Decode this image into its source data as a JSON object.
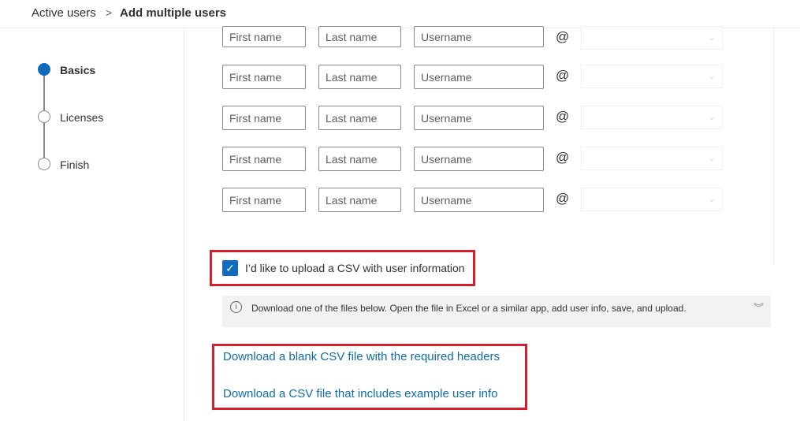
{
  "breadcrumb": {
    "parent": "Active users",
    "separator": ">",
    "current": "Add multiple users"
  },
  "steps": [
    {
      "label": "Basics",
      "active": true
    },
    {
      "label": "Licenses",
      "active": false
    },
    {
      "label": "Finish",
      "active": false
    }
  ],
  "rows": {
    "first_placeholder": "First name",
    "last_placeholder": "Last name",
    "user_placeholder": "Username",
    "at": "@",
    "count": 5
  },
  "csv_checkbox": {
    "label": "I’d like to upload a CSV with user information",
    "checked": true
  },
  "info": {
    "text": "Download one of the files below. Open the file in Excel or a similar app, add user info, save, and upload.",
    "icon": "info-icon",
    "expand_icon": "double-chevron-down-icon"
  },
  "links": {
    "blank": "Download a blank CSV file with the required headers",
    "example": "Download a CSV file that includes example user info"
  },
  "colors": {
    "accent": "#0f6cbd",
    "highlight": "#d21f2c",
    "link": "#0f6ca8"
  }
}
